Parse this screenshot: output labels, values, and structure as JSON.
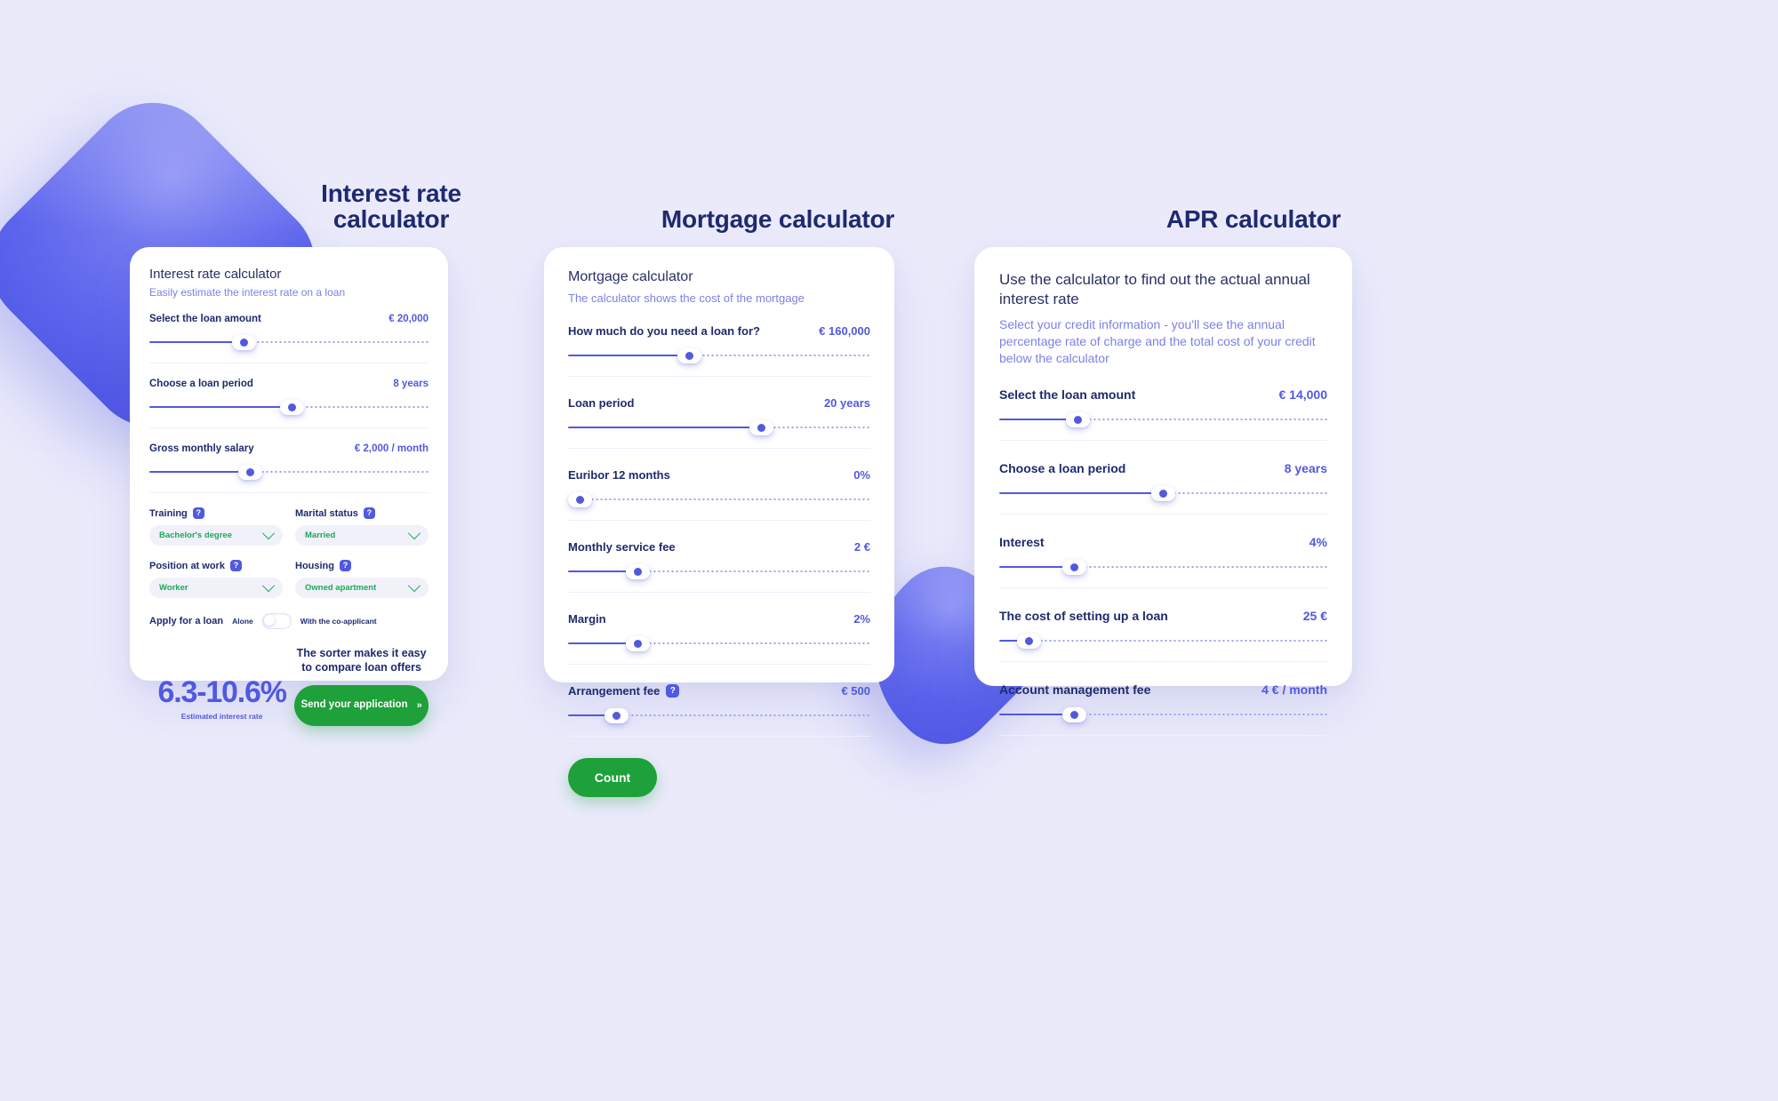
{
  "sections": {
    "interest_title": "Interest rate calculator",
    "mortgage_title": "Mortgage calculator",
    "apr_title": "APR calculator"
  },
  "interest_card": {
    "heading": "Interest rate calculator",
    "subheading": "Easily estimate the interest rate on a loan",
    "sliders": [
      {
        "label": "Select the loan amount",
        "value": "€ 20,000",
        "percent": 34
      },
      {
        "label": "Choose a loan period",
        "value": "8 years",
        "percent": 51
      },
      {
        "label": "Gross monthly salary",
        "value": "€ 2,000 / month",
        "percent": 36
      }
    ],
    "selects": [
      {
        "label": "Training",
        "help": "?",
        "value": "Bachelor's degree"
      },
      {
        "label": "Marital status",
        "help": "?",
        "value": "Married"
      },
      {
        "label": "Position at work",
        "help": "?",
        "value": "Worker"
      },
      {
        "label": "Housing",
        "help": "?",
        "value": "Owned apartment"
      }
    ],
    "toggle": {
      "label": "Apply for a loan",
      "option_left": "Alone",
      "option_right": "With the co-applicant",
      "state": "left"
    },
    "result": {
      "rate": "6.3-10.6%",
      "rate_caption": "Estimated interest rate",
      "promo": "The sorter makes it easy to compare loan offers",
      "cta": "Send your application",
      "cta_arrow": "»"
    }
  },
  "mortgage_card": {
    "heading": "Mortgage calculator",
    "subheading": "The calculator shows the cost of the mortgage",
    "sliders": [
      {
        "label": "How much do you need a loan for?",
        "value": "€ 160,000",
        "percent": 40,
        "help": null
      },
      {
        "label": "Loan period",
        "value": "20 years",
        "percent": 64,
        "help": null
      },
      {
        "label": "Euribor 12 months",
        "value": "0%",
        "percent": 4,
        "help": null
      },
      {
        "label": "Monthly service fee",
        "value": "2 €",
        "percent": 23,
        "help": null
      },
      {
        "label": "Margin",
        "value": "2%",
        "percent": 23,
        "help": null
      },
      {
        "label": "Arrangement fee",
        "value": "€ 500",
        "percent": 16,
        "help": "?"
      }
    ],
    "cta": "Count"
  },
  "apr_card": {
    "heading": "Use the calculator to find out the actual annual interest rate",
    "subheading": "Select your credit information - you'll see the annual percentage rate of charge and the total cost of your credit below the calculator",
    "sliders": [
      {
        "label": "Select the loan amount",
        "value": "€ 14,000",
        "percent": 24
      },
      {
        "label": "Choose a loan period",
        "value": "8 years",
        "percent": 50
      },
      {
        "label": "Interest",
        "value": "4%",
        "percent": 23
      },
      {
        "label": "The cost of setting up a loan",
        "value": "25 €",
        "percent": 9
      },
      {
        "label": "Account management fee",
        "value": "4 € / month",
        "percent": 23
      }
    ]
  },
  "colors": {
    "background": "#eaeafb",
    "accent_blue": "#5159e0",
    "navy": "#1f2a6e",
    "muted_blue": "#7b81e8",
    "green": "#1ea03a",
    "select_green": "#1fa85a"
  }
}
